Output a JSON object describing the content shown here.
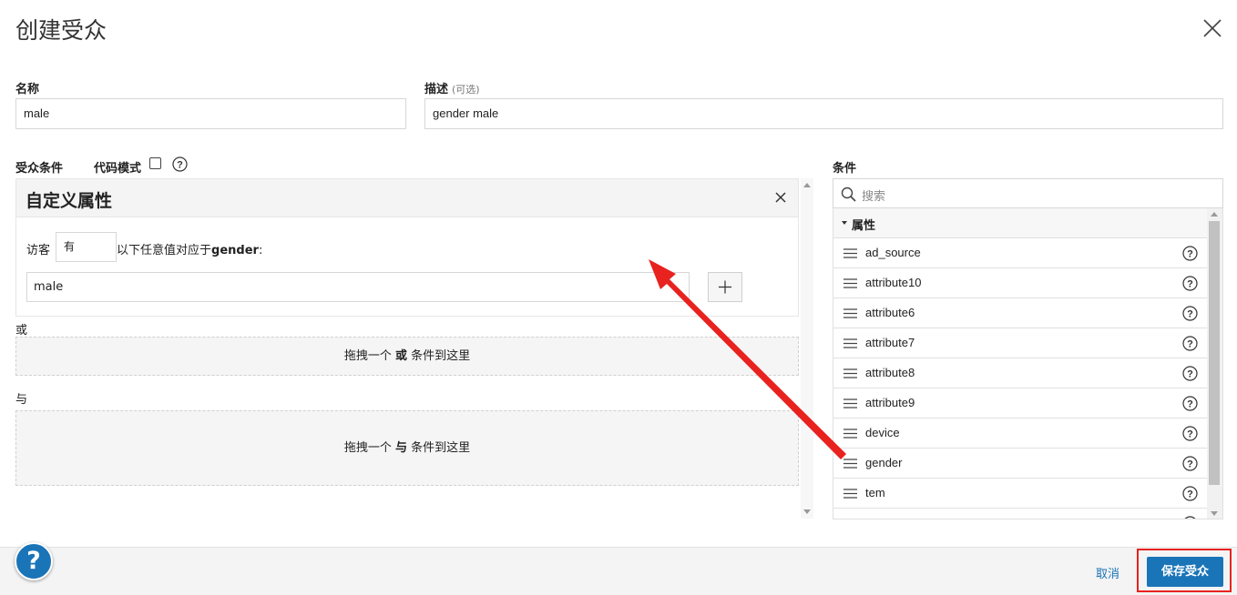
{
  "dialog": {
    "title": "创建受众"
  },
  "form": {
    "name_label": "名称",
    "name_value": "male",
    "desc_label": "描述",
    "desc_optional": "(可选)",
    "desc_value": "gender male"
  },
  "conditions": {
    "label": "受众条件",
    "code_mode_label": "代码模式",
    "code_mode_checked": false,
    "panel": {
      "title": "自定义属性",
      "visitor_label": "访客",
      "visitor_select": "有",
      "any_value_prefix": "以下任意值对应于",
      "attribute_name": "gender",
      "suffix": ":",
      "value": "male"
    },
    "or_label": "或",
    "or_drop_prefix": "拖拽一个",
    "or_drop_keyword": "或",
    "or_drop_suffix": "条件到这里",
    "and_label": "与",
    "and_drop_prefix": "拖拽一个",
    "and_drop_keyword": "与",
    "and_drop_suffix": "条件到这里"
  },
  "sidebar": {
    "label": "条件",
    "search_placeholder": "搜索",
    "group": "属性",
    "items": [
      {
        "label": "ad_source"
      },
      {
        "label": "attribute10"
      },
      {
        "label": "attribute6"
      },
      {
        "label": "attribute7"
      },
      {
        "label": "attribute8"
      },
      {
        "label": "attribute9"
      },
      {
        "label": "device"
      },
      {
        "label": "gender"
      },
      {
        "label": "tem"
      }
    ]
  },
  "footer": {
    "help": "?",
    "cancel": "取消",
    "save": "保存受众"
  },
  "colors": {
    "accent": "#1a74b8",
    "highlight": "#e8221f"
  }
}
